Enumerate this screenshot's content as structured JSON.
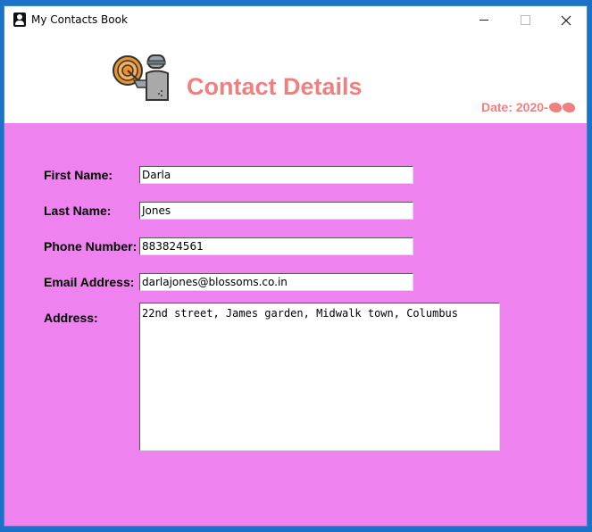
{
  "window": {
    "title": "My Contacts Book",
    "icon": "contact-book-icon"
  },
  "header": {
    "heading": "Contact Details",
    "date_label": "Date: 2020-",
    "logo_icon": "contact-finder-icon"
  },
  "form": {
    "first_name": {
      "label": "First Name:",
      "value": "Darla"
    },
    "last_name": {
      "label": "Last Name:",
      "value": "Jones"
    },
    "phone": {
      "label": "Phone Number:",
      "value": "883824561"
    },
    "email": {
      "label": "Email Address:",
      "value": "darlajones@blossoms.co.in"
    },
    "address": {
      "label": "Address:",
      "value": "22nd street, James garden, Midwalk town, Columbus"
    }
  },
  "colors": {
    "accent": "#f08080",
    "form_background": "#ee82ee"
  }
}
